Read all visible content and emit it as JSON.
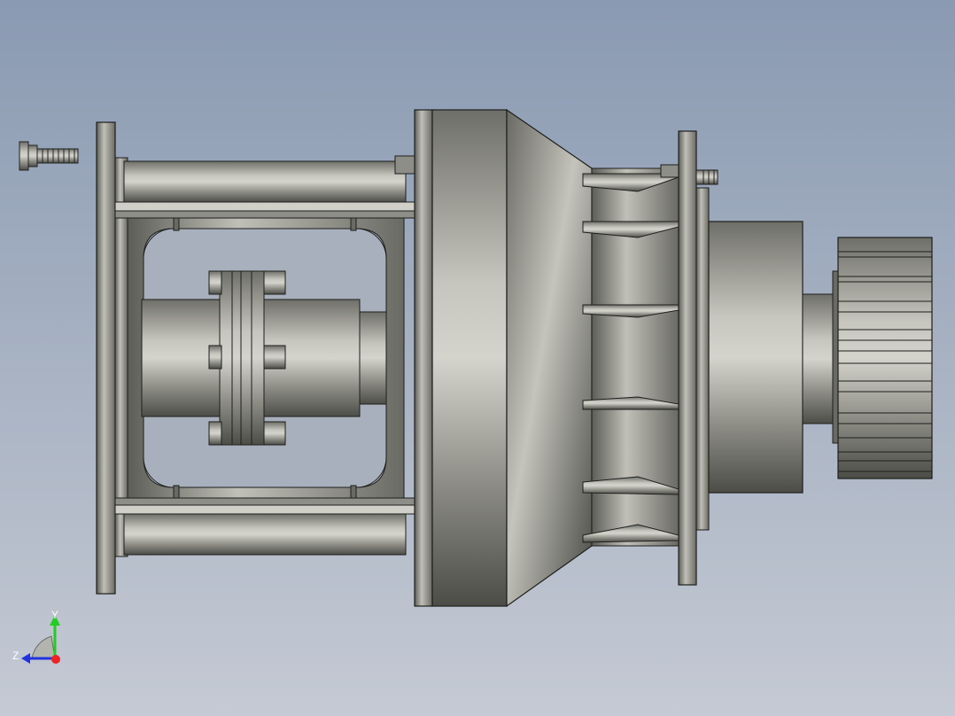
{
  "viewport": {
    "background_top": "#8a9ab2",
    "background_bottom": "#c5cad4",
    "model_color": "#9c9c94"
  },
  "triad": {
    "y_label": "Y",
    "z_label": "Z",
    "y_color": "#22cc22",
    "z_color": "#2233dd",
    "x_color": "#ee2222"
  }
}
